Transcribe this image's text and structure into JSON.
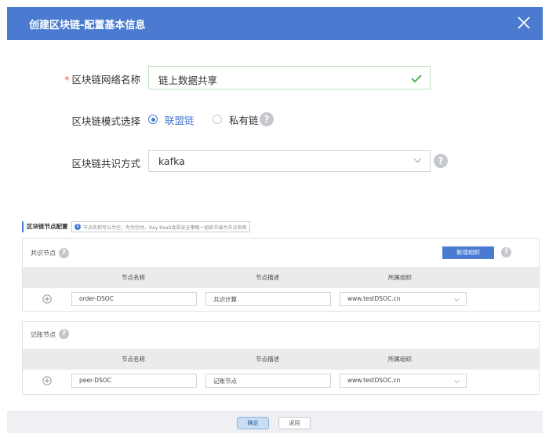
{
  "dialog": {
    "title": "创建区块链-配置基本信息"
  },
  "form": {
    "network_name": {
      "required_mark": "*",
      "label": "区块链网络名称",
      "value": "链上数据共享"
    },
    "mode": {
      "label": "区块链模式选择",
      "options": [
        {
          "label": "联盟链",
          "selected": true
        },
        {
          "label": "私有链",
          "selected": false
        }
      ],
      "help": "?"
    },
    "consensus": {
      "label": "区块链共识方式",
      "value": "kafka",
      "help": "?"
    }
  },
  "node_config": {
    "section_label": "区块链节点配置",
    "tip_icon": "i",
    "tip_text": "节点名称可以为空，为为空时，Ray BaaS会因安全策略一组织节省为节点名称",
    "consensus_panel": {
      "title": "共识节点",
      "help": "?",
      "add_org_button": "新增组织",
      "add_help": "?",
      "columns": [
        "节点名称",
        "节点描述",
        "所属组织"
      ],
      "rows": [
        {
          "name": "order-DSOC",
          "desc": "共识计算",
          "org": "www.testDSOC.cn"
        }
      ]
    },
    "ledger_panel": {
      "title": "记账节点",
      "help": "?",
      "columns": [
        "节点名称",
        "节点描述",
        "所属组织"
      ],
      "rows": [
        {
          "name": "peer-DSOC",
          "desc": "记账节点",
          "org": "www.testDSOC.cn"
        }
      ]
    }
  },
  "footer": {
    "confirm_label": "确定",
    "back_label": "返回"
  },
  "colors": {
    "header": "#4a7bd0",
    "accent": "#4a7bd0",
    "valid": "#52b35a"
  },
  "icons": [
    "close-icon",
    "check-icon",
    "help-icon",
    "chevron-down-icon",
    "info-icon",
    "plus-circle-icon"
  ]
}
